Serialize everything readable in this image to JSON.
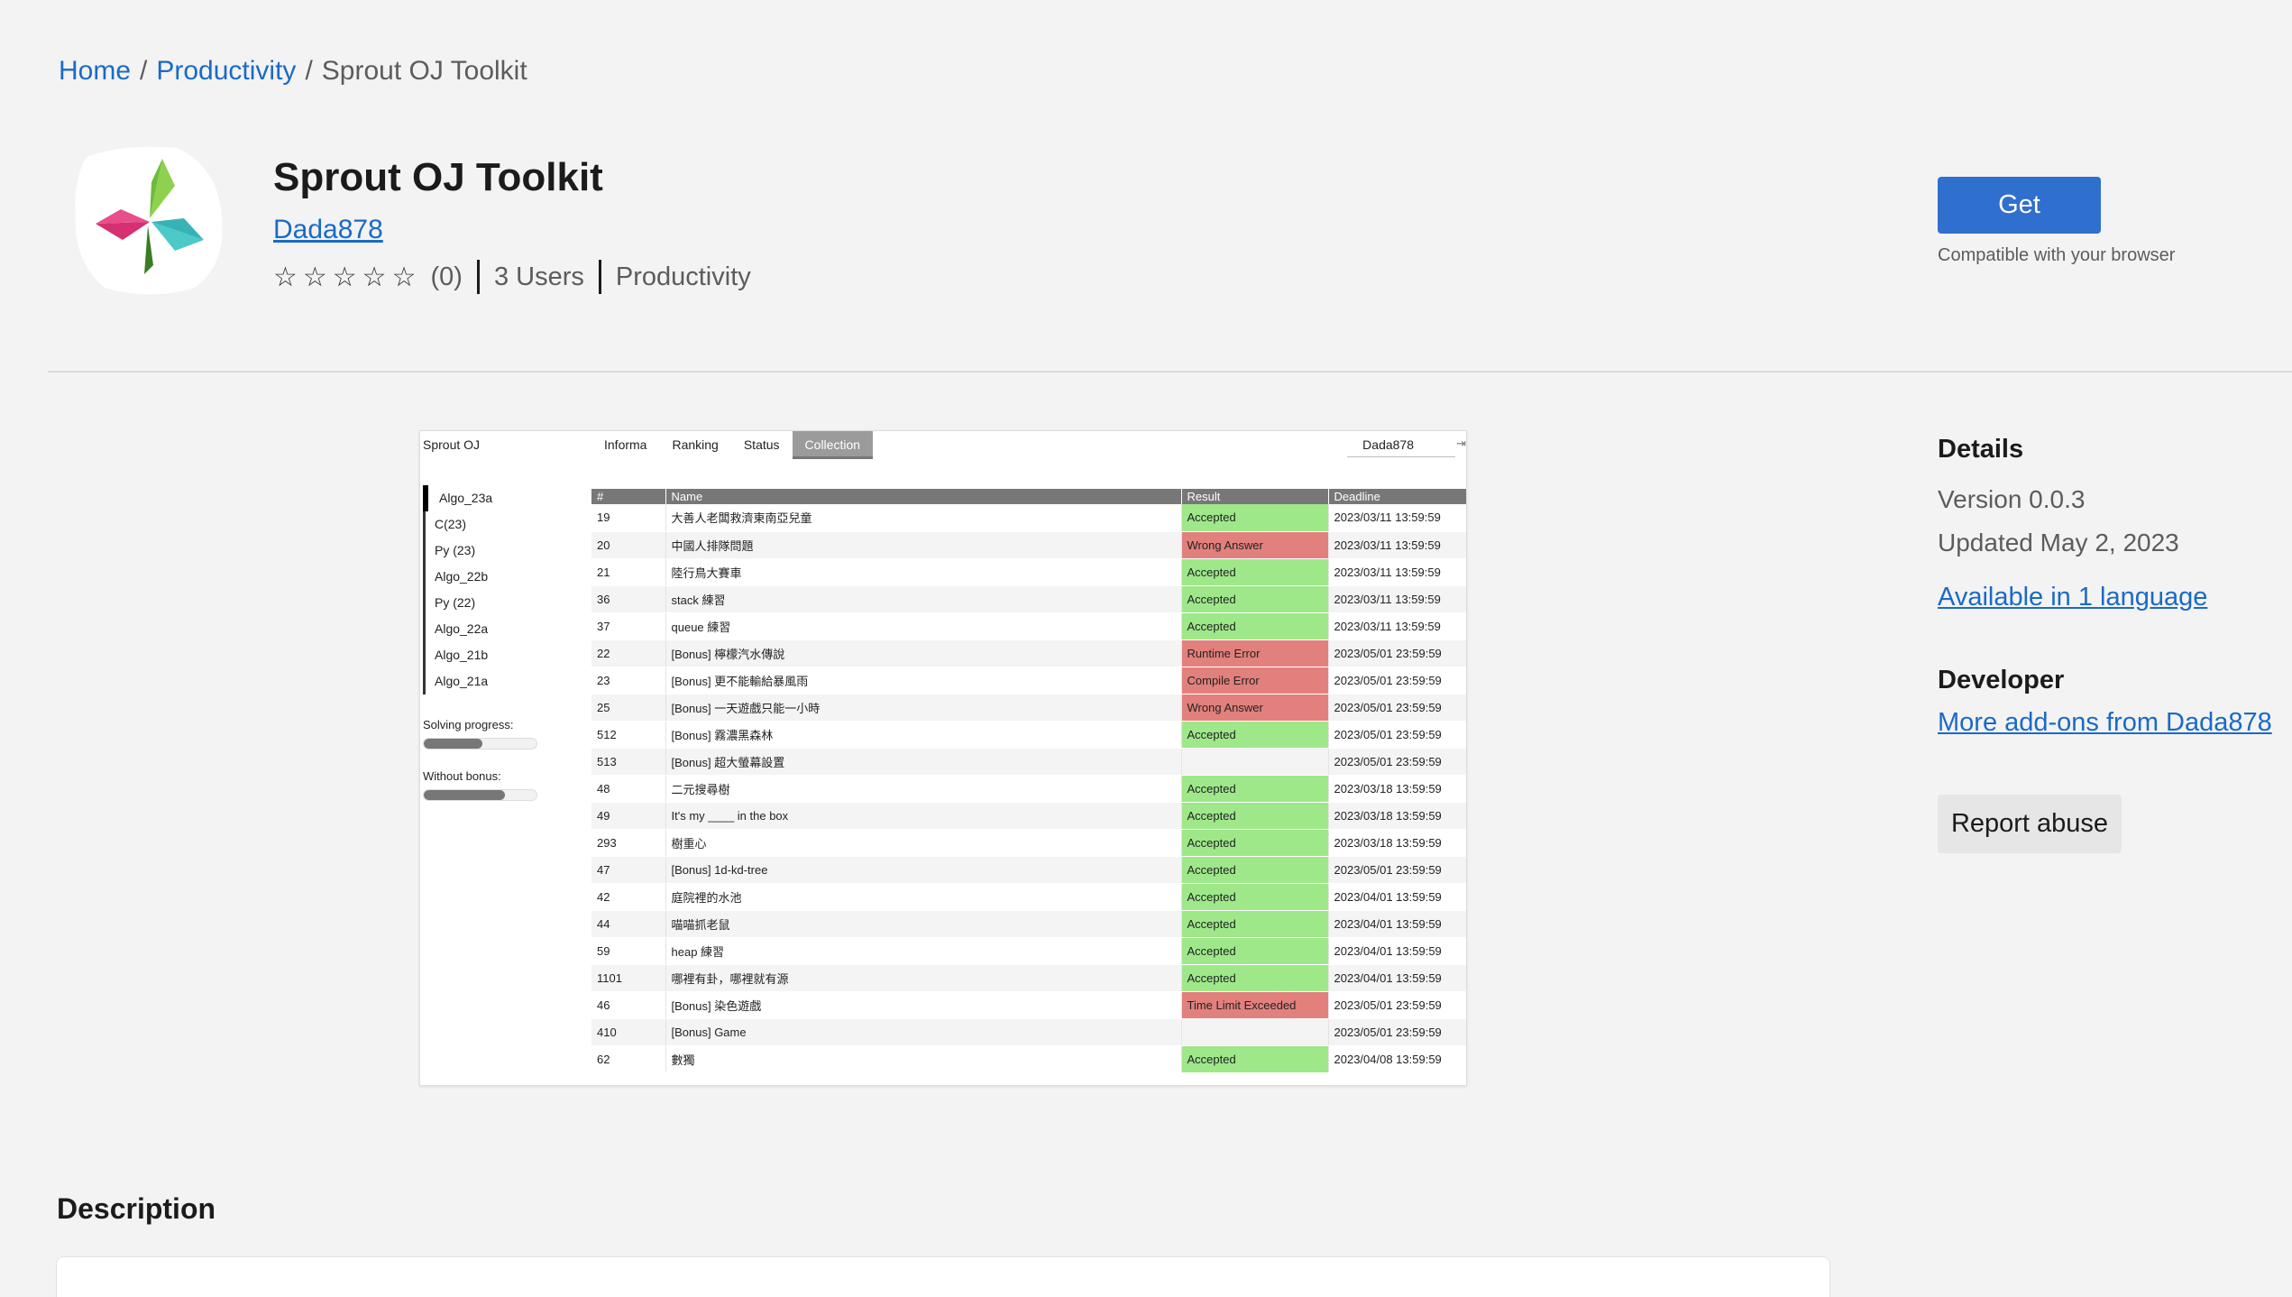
{
  "breadcrumb": {
    "home": "Home",
    "category": "Productivity",
    "current": "Sprout OJ Toolkit"
  },
  "extension": {
    "title": "Sprout OJ Toolkit",
    "author": "Dada878",
    "stars": "☆☆☆☆☆",
    "rating_count": "(0)",
    "users": "3 Users",
    "category": "Productivity",
    "get_label": "Get",
    "compat": "Compatible with your browser"
  },
  "screenshot": {
    "brand": "Sprout OJ",
    "tabs": [
      "Informa",
      "Ranking",
      "Status",
      "Collection"
    ],
    "user": "Dada878",
    "sidebar": [
      "Algo_23a",
      "C(23)",
      "Py (23)",
      "Algo_22b",
      "Py (22)",
      "Algo_22a",
      "Algo_21b",
      "Algo_21a"
    ],
    "solving_progress_label": "Solving progress:",
    "without_bonus_label": "Without bonus:",
    "solving_progress": 0.52,
    "without_bonus": 0.72,
    "columns": [
      "#",
      "Name",
      "Result",
      "Deadline"
    ],
    "rows": [
      {
        "id": "19",
        "name": "大善人老闆救濟東南亞兒童",
        "result": "Accepted",
        "deadline": "2023/03/11 13:59:59"
      },
      {
        "id": "20",
        "name": "中國人排隊問題",
        "result": "Wrong Answer",
        "deadline": "2023/03/11 13:59:59"
      },
      {
        "id": "21",
        "name": "陸行鳥大賽車",
        "result": "Accepted",
        "deadline": "2023/03/11 13:59:59"
      },
      {
        "id": "36",
        "name": "stack 練習",
        "result": "Accepted",
        "deadline": "2023/03/11 13:59:59"
      },
      {
        "id": "37",
        "name": "queue 練習",
        "result": "Accepted",
        "deadline": "2023/03/11 13:59:59"
      },
      {
        "id": "22",
        "name": "[Bonus] 檸檬汽水傳說",
        "result": "Runtime Error",
        "deadline": "2023/05/01 23:59:59"
      },
      {
        "id": "23",
        "name": "[Bonus] 更不能輸給暴風雨",
        "result": "Compile Error",
        "deadline": "2023/05/01 23:59:59"
      },
      {
        "id": "25",
        "name": "[Bonus] 一天遊戲只能一小時",
        "result": "Wrong Answer",
        "deadline": "2023/05/01 23:59:59"
      },
      {
        "id": "512",
        "name": "[Bonus] 霧濃黑森林",
        "result": "Accepted",
        "deadline": "2023/05/01 23:59:59"
      },
      {
        "id": "513",
        "name": "[Bonus] 超大螢幕設置",
        "result": "",
        "deadline": "2023/05/01 23:59:59"
      },
      {
        "id": "48",
        "name": "二元搜尋樹",
        "result": "Accepted",
        "deadline": "2023/03/18 13:59:59"
      },
      {
        "id": "49",
        "name": "It's my ____ in the box",
        "result": "Accepted",
        "deadline": "2023/03/18 13:59:59"
      },
      {
        "id": "293",
        "name": "樹重心",
        "result": "Accepted",
        "deadline": "2023/03/18 13:59:59"
      },
      {
        "id": "47",
        "name": "[Bonus] 1d-kd-tree",
        "result": "Accepted",
        "deadline": "2023/05/01 23:59:59"
      },
      {
        "id": "42",
        "name": "庭院裡的水池",
        "result": "Accepted",
        "deadline": "2023/04/01 13:59:59"
      },
      {
        "id": "44",
        "name": "喵喵抓老鼠",
        "result": "Accepted",
        "deadline": "2023/04/01 13:59:59"
      },
      {
        "id": "59",
        "name": "heap 練習",
        "result": "Accepted",
        "deadline": "2023/04/01 13:59:59"
      },
      {
        "id": "1101",
        "name": "哪裡有卦，哪裡就有源",
        "result": "Accepted",
        "deadline": "2023/04/01 13:59:59"
      },
      {
        "id": "46",
        "name": "[Bonus] 染色遊戲",
        "result": "Time Limit Exceeded",
        "deadline": "2023/05/01 23:59:59"
      },
      {
        "id": "410",
        "name": "[Bonus] Game",
        "result": "",
        "deadline": "2023/05/01 23:59:59"
      },
      {
        "id": "62",
        "name": "數獨",
        "result": "Accepted",
        "deadline": "2023/04/08 13:59:59"
      }
    ]
  },
  "details": {
    "heading": "Details",
    "version": "Version 0.0.3",
    "updated": "Updated May 2, 2023",
    "languages": "Available in 1 language"
  },
  "developer": {
    "heading": "Developer",
    "more": "More add-ons from Dada878",
    "report": "Report abuse"
  },
  "description": {
    "heading": "Description"
  },
  "colors": {
    "accent": "#2f6fce",
    "link": "#1a6ac6",
    "accepted": "#9ee88a",
    "error": "#e1807c"
  },
  "icons": {
    "logo": "pinwheel-logo-icon",
    "logout": "logout-icon"
  }
}
